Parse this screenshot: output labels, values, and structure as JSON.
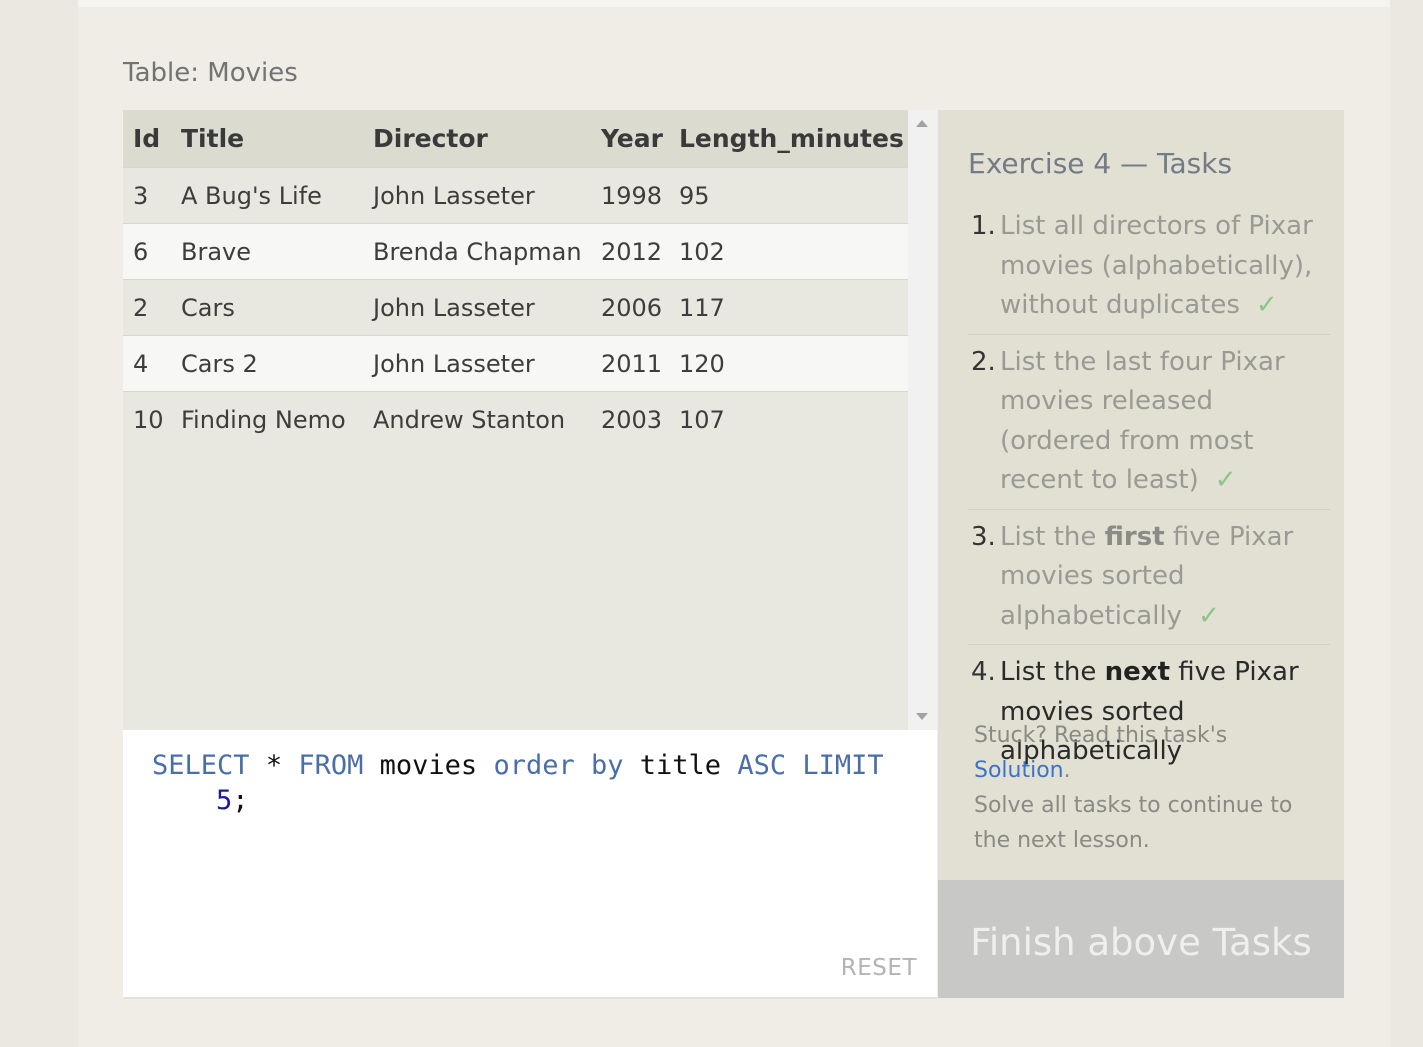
{
  "table": {
    "caption": "Table: Movies",
    "columns": [
      "Id",
      "Title",
      "Director",
      "Year",
      "Length_minutes"
    ],
    "rows": [
      [
        "3",
        "A Bug's Life",
        "John Lasseter",
        "1998",
        "95"
      ],
      [
        "6",
        "Brave",
        "Brenda Chapman",
        "2012",
        "102"
      ],
      [
        "2",
        "Cars",
        "John Lasseter",
        "2006",
        "117"
      ],
      [
        "4",
        "Cars 2",
        "John Lasseter",
        "2011",
        "120"
      ],
      [
        "10",
        "Finding Nemo",
        "Andrew Stanton",
        "2003",
        "107"
      ]
    ]
  },
  "editor": {
    "tokens": {
      "select": "SELECT",
      "star": "*",
      "from": "FROM",
      "table": "movies",
      "order_by": "order by",
      "column": "title",
      "asc": "ASC",
      "limit": "LIMIT",
      "limit_value": "5",
      "terminator": ";"
    },
    "reset_label": "RESET"
  },
  "tasks": {
    "title": "Exercise 4 — Tasks",
    "items": [
      {
        "num": "1.",
        "text": "List all directors of Pixar movies (alphabetically), without duplicates",
        "done": true
      },
      {
        "num": "2.",
        "text": "List the last four Pixar movies released (ordered from most recent to least)",
        "done": true
      },
      {
        "num": "3.",
        "pre": "List the ",
        "bold": "first",
        "post": " five Pixar movies sorted alphabetically",
        "done": true
      },
      {
        "num": "4.",
        "pre": "List the ",
        "bold": "next",
        "post": " five Pixar movies sorted alphabetically",
        "done": false
      }
    ],
    "check_glyph": "✓",
    "stuck_text": "Stuck? Read this task's",
    "solution_link": "Solution",
    "stuck_period": ".",
    "continue_text": "Solve all tasks to continue to the next lesson."
  },
  "finish_button": "Finish above Tasks",
  "colors": {
    "keyword": "#4a6ea9",
    "number": "#1a1a9e",
    "check": "#8cc48c",
    "link": "#3a74c4",
    "finish_bg": "#c8c8c6"
  }
}
